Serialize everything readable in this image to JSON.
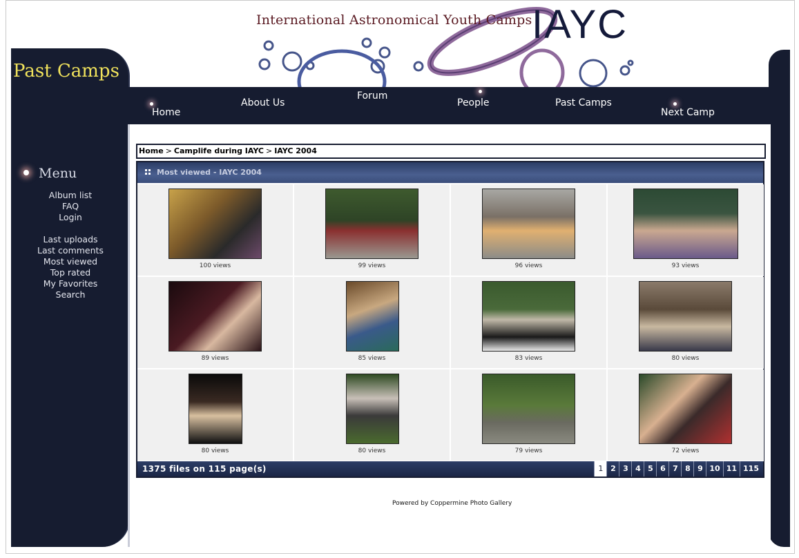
{
  "header": {
    "tagline": "International Astronomical Youth Camps",
    "brand": "IAYC"
  },
  "sidebar": {
    "title": "Past Camps",
    "menu_title": "Menu",
    "group1": [
      "Album list",
      "FAQ",
      "Login"
    ],
    "group2": [
      "Last uploads",
      "Last comments",
      "Most viewed",
      "Top rated",
      "My Favorites",
      "Search"
    ]
  },
  "nav": {
    "home": "Home",
    "about": "About Us",
    "forum": "Forum",
    "people": "People",
    "past": "Past Camps",
    "next": "Next Camp"
  },
  "breadcrumb": {
    "home": "Home",
    "album": "Camplife during IAYC",
    "current": "IAYC 2004",
    "separator": ">"
  },
  "gallery": {
    "title": "Most viewed - IAYC 2004",
    "items": [
      {
        "views": "100 views"
      },
      {
        "views": "99 views"
      },
      {
        "views": "96 views"
      },
      {
        "views": "93 views"
      },
      {
        "views": "89 views"
      },
      {
        "views": "85 views"
      },
      {
        "views": "83 views"
      },
      {
        "views": "80 views"
      },
      {
        "views": "80 views"
      },
      {
        "views": "80 views"
      },
      {
        "views": "79 views"
      },
      {
        "views": "72 views"
      }
    ],
    "files_summary": "1375 files on 115 page(s)",
    "pages": [
      "1",
      "2",
      "3",
      "4",
      "5",
      "6",
      "7",
      "8",
      "9",
      "10",
      "11",
      "115"
    ]
  },
  "footer": {
    "powered_prefix": "Powered by",
    "powered_link": "Coppermine Photo Gallery"
  },
  "colors": {
    "navy": "#161c30",
    "header_band": "#3a4d7a",
    "sidebar_title": "#f0e25c",
    "tagline": "#5a1a22"
  }
}
